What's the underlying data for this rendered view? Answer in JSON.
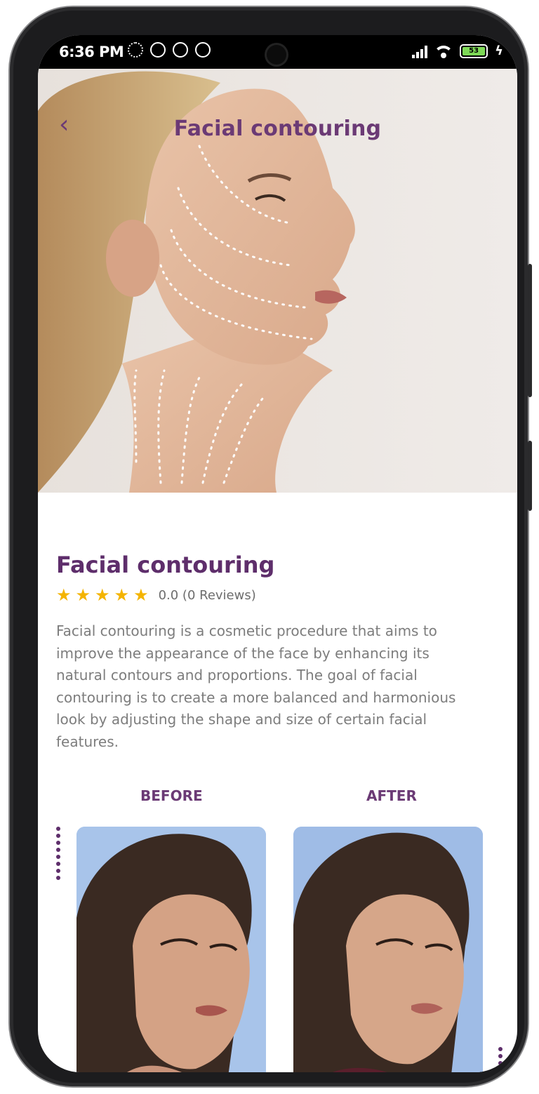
{
  "status_bar": {
    "time": "6:36 PM",
    "battery_label": "53",
    "battery_color": "#7ed957"
  },
  "header": {
    "back_icon": "chevron-left-icon",
    "title": "Facial contouring"
  },
  "treatment": {
    "name": "Facial contouring",
    "rating_stars": 5,
    "rating_text": "0.0 (0 Reviews)",
    "description": "Facial contouring is a cosmetic procedure that aims to improve the appearance of the face by enhancing its natural contours and proportions. The goal of facial contouring is to create a more balanced and harmonious look by adjusting the shape and size of certain facial features."
  },
  "comparison": {
    "before_label": "BEFORE",
    "after_label": "AFTER"
  },
  "colors": {
    "brand_purple": "#5e2e6b",
    "star": "#f4b400",
    "body_text": "#7d7d7d"
  }
}
